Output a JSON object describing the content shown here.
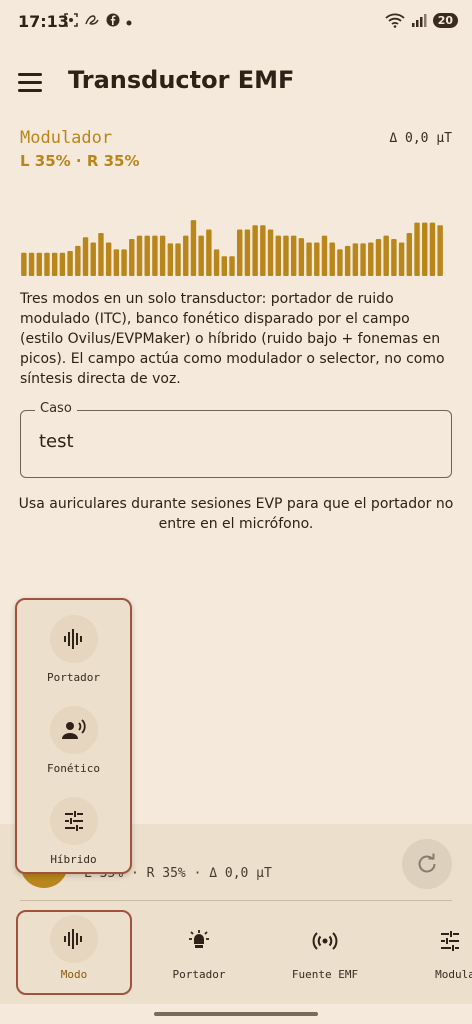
{
  "status_bar": {
    "time": "17:13",
    "battery": "20"
  },
  "app_bar": {
    "title": "Transductor EMF"
  },
  "modulator": {
    "label": "Modulador",
    "levels": "L 35% · R 35%",
    "delta": "Δ 0,0 µT",
    "bar_color": "#b8861b",
    "bar_levels": [
      0.27,
      0.27,
      0.27,
      0.27,
      0.27,
      0.27,
      0.29,
      0.35,
      0.45,
      0.39,
      0.5,
      0.39,
      0.31,
      0.31,
      0.43,
      0.47,
      0.47,
      0.47,
      0.47,
      0.38,
      0.38,
      0.47,
      0.65,
      0.47,
      0.54,
      0.31,
      0.23,
      0.23,
      0.54,
      0.54,
      0.59,
      0.59,
      0.54,
      0.47,
      0.47,
      0.47,
      0.44,
      0.39,
      0.39,
      0.47,
      0.39,
      0.31,
      0.35,
      0.38,
      0.38,
      0.39,
      0.43,
      0.47,
      0.43,
      0.39,
      0.5,
      0.62,
      0.62,
      0.62,
      0.59
    ]
  },
  "description": "Tres modos en un solo transductor: portador de ruido modulado (ITC), banco fonético disparado por el campo (estilo Ovilus/EVPMaker) o híbrido (ruido bajo + fonemas en picos). El campo actúa como modulador o selector, no como síntesis directa de voz.",
  "case_field": {
    "label": "Caso",
    "value": "test"
  },
  "hint": "Usa auriculares durante sesiones EVP para que el portador no entre en el micrófono.",
  "mode_menu": {
    "items": [
      {
        "label": "Portador",
        "icon": "waveform-icon"
      },
      {
        "label": "Fonético",
        "icon": "voice-icon"
      },
      {
        "label": "Híbrido",
        "icon": "tune-icon"
      }
    ]
  },
  "player": {
    "status": "L 35% · R 35% · Δ 0,0 µT"
  },
  "bottom_nav": {
    "items": [
      {
        "label": "Modo",
        "icon": "waveform-icon",
        "active": true
      },
      {
        "label": "Portador",
        "icon": "lamp-icon"
      },
      {
        "label": "Fuente EMF",
        "icon": "broadcast-icon"
      },
      {
        "label": "Modula",
        "icon": "tune-icon"
      }
    ]
  },
  "colors": {
    "background": "#f4e9da",
    "accent": "#b8861b",
    "highlight_border": "#a0523d",
    "panel": "#ecdfcb"
  }
}
